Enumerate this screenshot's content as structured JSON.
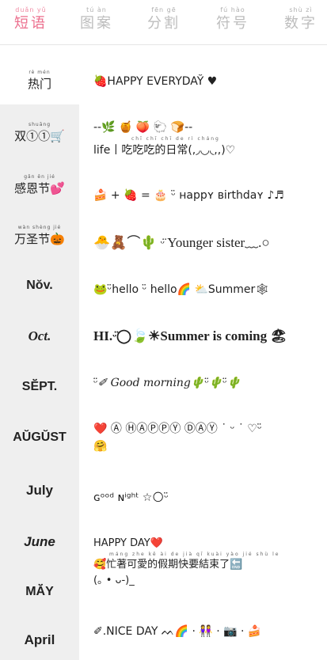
{
  "tabs": [
    {
      "pinyin": "duǎn yǔ",
      "label": "短语",
      "active": true
    },
    {
      "pinyin": "tú àn",
      "label": "图案",
      "active": false
    },
    {
      "pinyin": "fēn gē",
      "label": "分割",
      "active": false
    },
    {
      "pinyin": "fú hào",
      "label": "符号",
      "active": false
    },
    {
      "pinyin": "shù zì",
      "label": "数字",
      "active": false
    }
  ],
  "sidebar": {
    "items": [
      {
        "pinyin": "rè mén",
        "label": "热门"
      },
      {
        "pinyin": "shuāng",
        "label": "双①①🛒"
      },
      {
        "pinyin": "gǎn ēn jié",
        "label": "感恩节💕"
      },
      {
        "pinyin": "wàn shèng jié",
        "label": "万圣节🎃"
      },
      {
        "label": "Nŏv."
      },
      {
        "label": "Oct."
      },
      {
        "label": "SĔ̈PT."
      },
      {
        "label": "AŬGŬST"
      },
      {
        "label": "July"
      },
      {
        "label": "June"
      },
      {
        "label": "MĂ̈Y"
      },
      {
        "label": "April"
      }
    ]
  },
  "content": {
    "rows": [
      {
        "text": "🍓HAPPY EVERYDAY̆ ♥"
      },
      {
        "line1": "--🌿  🍯  🍑  🐑  🍞--",
        "pinyin": "chī chī chī de rì cháng",
        "line2": "life丨吃吃吃的日常(,◞◡◟,,)♡"
      },
      {
        "text": "🍰 + 🍓 = 🎂 ᵕ̈ ʜappʏ ʙirthdaʏ ♪♬"
      },
      {
        "text": "🐣🧸⌒🌵 ᵕ̈ Younger sister﹏.○"
      },
      {
        "text": "🐸ᵕ̈hello ᵕ̈ hello🌈   ⛅Summer🕸"
      },
      {
        "text": "HI.ᵕ̈◯🍃☀Summer is coming 🏖"
      },
      {
        "text": "ᵕ̈✐ Good morning🌵ᵕ̈🌵ᵕ̈🌵"
      },
      {
        "line1": "❤️ Ⓐ ⒽⒶⓅⓅⓎ ⒹⒶⓎ ˙ ᵕ ˙ ♡ᵕ̈",
        "line2": "🤗"
      },
      {
        "text": "ɢᵒᵒᵈ ɴⁱᵍʰᵗ ☆🌕ᵕ̈"
      },
      {
        "line1": "HAPPY DAY❤️",
        "pinyin": "máng zhe kě ài de jià qī kuài yào jié shù le",
        "line2": "🥰忙著可愛的假期快要結束了🔚",
        "line3": "(｡ • ᴗ-)_"
      },
      {
        "text": "✐.NICE DAY ᨓ🌈 · 👭 · 📷 · 🍰"
      }
    ]
  },
  "colors": {
    "accent": "#ec6f8e",
    "sidebar_bg": "#efefef",
    "divider": "#e6e6e6"
  }
}
